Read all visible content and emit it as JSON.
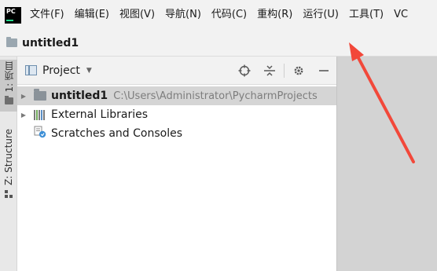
{
  "app": {
    "logo_text": "PC"
  },
  "menu": {
    "items": [
      {
        "label": "文件(F)"
      },
      {
        "label": "编辑(E)"
      },
      {
        "label": "视图(V)"
      },
      {
        "label": "导航(N)"
      },
      {
        "label": "代码(C)"
      },
      {
        "label": "重构(R)"
      },
      {
        "label": "运行(U)"
      },
      {
        "label": "工具(T)"
      },
      {
        "label": "VC"
      }
    ]
  },
  "titlebar": {
    "project_name": "untitled1"
  },
  "left_strip": {
    "project_tab": "1: 项目",
    "structure_tab": "Z: Structure"
  },
  "panel": {
    "view_label": "Project",
    "tree": [
      {
        "label": "untitled1",
        "path": "C:\\Users\\Administrator\\PycharmProjects"
      },
      {
        "label": "External Libraries"
      },
      {
        "label": "Scratches and Consoles"
      }
    ]
  },
  "colors": {
    "annotation_arrow": "#f2483a",
    "editor_background": "#d3d3d3",
    "selection": "#d5d5d5"
  },
  "icons": {
    "logo": "pycharm-logo-icon",
    "title_folder": "folder-icon",
    "locate": "crosshair-icon",
    "collapse": "collapse-all-icon",
    "settings": "gear-icon",
    "hide": "minimize-icon"
  }
}
